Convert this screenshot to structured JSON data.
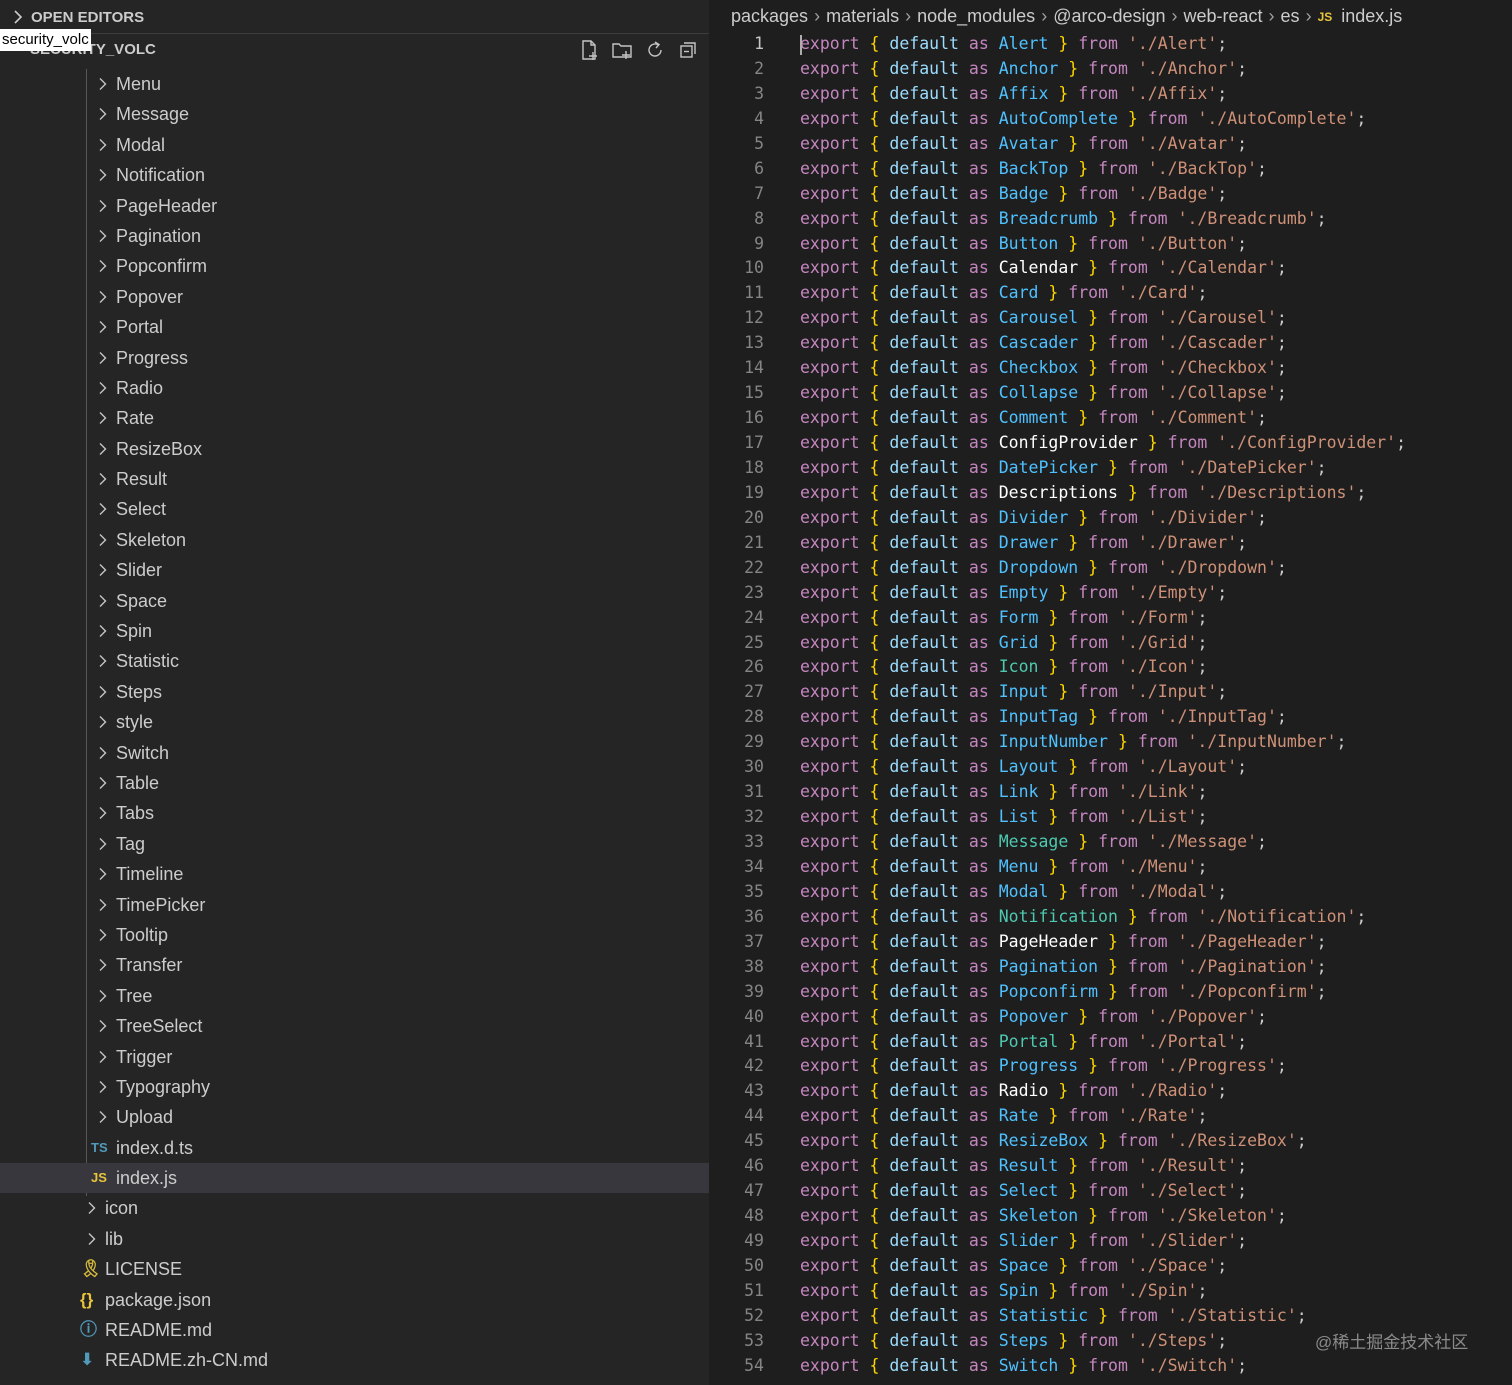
{
  "open_editors": {
    "label": "OPEN EDITORS"
  },
  "tooltip": "security_volc",
  "workspace_title": "SECURITY_VOLC",
  "explorer_actions": [
    {
      "name": "new-file-icon"
    },
    {
      "name": "new-folder-icon"
    },
    {
      "name": "refresh-icon"
    },
    {
      "name": "collapse-all-icon"
    }
  ],
  "tree": [
    {
      "label": "Menu",
      "kind": "folder",
      "depth": 2
    },
    {
      "label": "Message",
      "kind": "folder",
      "depth": 2
    },
    {
      "label": "Modal",
      "kind": "folder",
      "depth": 2
    },
    {
      "label": "Notification",
      "kind": "folder",
      "depth": 2
    },
    {
      "label": "PageHeader",
      "kind": "folder",
      "depth": 2
    },
    {
      "label": "Pagination",
      "kind": "folder",
      "depth": 2
    },
    {
      "label": "Popconfirm",
      "kind": "folder",
      "depth": 2
    },
    {
      "label": "Popover",
      "kind": "folder",
      "depth": 2
    },
    {
      "label": "Portal",
      "kind": "folder",
      "depth": 2
    },
    {
      "label": "Progress",
      "kind": "folder",
      "depth": 2
    },
    {
      "label": "Radio",
      "kind": "folder",
      "depth": 2
    },
    {
      "label": "Rate",
      "kind": "folder",
      "depth": 2
    },
    {
      "label": "ResizeBox",
      "kind": "folder",
      "depth": 2
    },
    {
      "label": "Result",
      "kind": "folder",
      "depth": 2
    },
    {
      "label": "Select",
      "kind": "folder",
      "depth": 2
    },
    {
      "label": "Skeleton",
      "kind": "folder",
      "depth": 2
    },
    {
      "label": "Slider",
      "kind": "folder",
      "depth": 2
    },
    {
      "label": "Space",
      "kind": "folder",
      "depth": 2
    },
    {
      "label": "Spin",
      "kind": "folder",
      "depth": 2
    },
    {
      "label": "Statistic",
      "kind": "folder",
      "depth": 2
    },
    {
      "label": "Steps",
      "kind": "folder",
      "depth": 2
    },
    {
      "label": "style",
      "kind": "folder",
      "depth": 2
    },
    {
      "label": "Switch",
      "kind": "folder",
      "depth": 2
    },
    {
      "label": "Table",
      "kind": "folder",
      "depth": 2
    },
    {
      "label": "Tabs",
      "kind": "folder",
      "depth": 2
    },
    {
      "label": "Tag",
      "kind": "folder",
      "depth": 2
    },
    {
      "label": "Timeline",
      "kind": "folder",
      "depth": 2
    },
    {
      "label": "TimePicker",
      "kind": "folder",
      "depth": 2
    },
    {
      "label": "Tooltip",
      "kind": "folder",
      "depth": 2
    },
    {
      "label": "Transfer",
      "kind": "folder",
      "depth": 2
    },
    {
      "label": "Tree",
      "kind": "folder",
      "depth": 2
    },
    {
      "label": "TreeSelect",
      "kind": "folder",
      "depth": 2
    },
    {
      "label": "Trigger",
      "kind": "folder",
      "depth": 2
    },
    {
      "label": "Typography",
      "kind": "folder",
      "depth": 2
    },
    {
      "label": "Upload",
      "kind": "folder",
      "depth": 2
    },
    {
      "label": "index.d.ts",
      "kind": "file",
      "depth": 2,
      "icon": "TS",
      "icon_color": "#519aba"
    },
    {
      "label": "index.js",
      "kind": "file",
      "depth": 2,
      "icon": "JS",
      "icon_color": "#e8c53a",
      "selected": true
    },
    {
      "label": "icon",
      "kind": "folder",
      "depth": 1
    },
    {
      "label": "lib",
      "kind": "folder",
      "depth": 1
    },
    {
      "label": "LICENSE",
      "kind": "file",
      "depth": 1,
      "icon": "license-icon",
      "icon_color": "#d4b83c"
    },
    {
      "label": "package.json",
      "kind": "file",
      "depth": 1,
      "icon": "json-icon",
      "icon_color": "#e8c53a"
    },
    {
      "label": "README.md",
      "kind": "file",
      "depth": 1,
      "icon": "info-icon",
      "icon_color": "#519aba"
    },
    {
      "label": "README.zh-CN.md",
      "kind": "file",
      "depth": 1,
      "icon": "download-icon",
      "icon_color": "#519aba"
    }
  ],
  "breadcrumb": [
    "packages",
    "materials",
    "node_modules",
    "@arco-design",
    "web-react",
    "es",
    "index.js"
  ],
  "breadcrumb_file_icon": "JS",
  "code": {
    "kw": "export",
    "default": "default",
    "as": "as",
    "from": "from",
    "lines": [
      {
        "n": "1",
        "name": "Alert",
        "path": "'./Alert'"
      },
      {
        "n": "2",
        "name": "Anchor",
        "path": "'./Anchor'"
      },
      {
        "n": "3",
        "name": "Affix",
        "path": "'./Affix'"
      },
      {
        "n": "4",
        "name": "AutoComplete",
        "path": "'./AutoComplete'"
      },
      {
        "n": "5",
        "name": "Avatar",
        "path": "'./Avatar'"
      },
      {
        "n": "6",
        "name": "BackTop",
        "path": "'./BackTop'"
      },
      {
        "n": "7",
        "name": "Badge",
        "path": "'./Badge'"
      },
      {
        "n": "8",
        "name": "Breadcrumb",
        "path": "'./Breadcrumb'"
      },
      {
        "n": "9",
        "name": "Button",
        "path": "'./Button'"
      },
      {
        "n": "10",
        "name": "Calendar",
        "path": "'./Calendar'",
        "white": true
      },
      {
        "n": "11",
        "name": "Card",
        "path": "'./Card'"
      },
      {
        "n": "12",
        "name": "Carousel",
        "path": "'./Carousel'"
      },
      {
        "n": "13",
        "name": "Cascader",
        "path": "'./Cascader'"
      },
      {
        "n": "14",
        "name": "Checkbox",
        "path": "'./Checkbox'"
      },
      {
        "n": "15",
        "name": "Collapse",
        "path": "'./Collapse'"
      },
      {
        "n": "16",
        "name": "Comment",
        "path": "'./Comment'"
      },
      {
        "n": "17",
        "name": "ConfigProvider",
        "path": "'./ConfigProvider'",
        "white": true
      },
      {
        "n": "18",
        "name": "DatePicker",
        "path": "'./DatePicker'"
      },
      {
        "n": "19",
        "name": "Descriptions",
        "path": "'./Descriptions'",
        "white": true
      },
      {
        "n": "20",
        "name": "Divider",
        "path": "'./Divider'"
      },
      {
        "n": "21",
        "name": "Drawer",
        "path": "'./Drawer'"
      },
      {
        "n": "22",
        "name": "Dropdown",
        "path": "'./Dropdown'"
      },
      {
        "n": "23",
        "name": "Empty",
        "path": "'./Empty'"
      },
      {
        "n": "24",
        "name": "Form",
        "path": "'./Form'"
      },
      {
        "n": "25",
        "name": "Grid",
        "path": "'./Grid'"
      },
      {
        "n": "26",
        "name": "Icon",
        "path": "'./Icon'",
        "cls": true
      },
      {
        "n": "27",
        "name": "Input",
        "path": "'./Input'"
      },
      {
        "n": "28",
        "name": "InputTag",
        "path": "'./InputTag'"
      },
      {
        "n": "29",
        "name": "InputNumber",
        "path": "'./InputNumber'"
      },
      {
        "n": "30",
        "name": "Layout",
        "path": "'./Layout'"
      },
      {
        "n": "31",
        "name": "Link",
        "path": "'./Link'"
      },
      {
        "n": "32",
        "name": "List",
        "path": "'./List'"
      },
      {
        "n": "33",
        "name": "Message",
        "path": "'./Message'",
        "cls": true
      },
      {
        "n": "34",
        "name": "Menu",
        "path": "'./Menu'"
      },
      {
        "n": "35",
        "name": "Modal",
        "path": "'./Modal'"
      },
      {
        "n": "36",
        "name": "Notification",
        "path": "'./Notification'",
        "cls": true
      },
      {
        "n": "37",
        "name": "PageHeader",
        "path": "'./PageHeader'",
        "white": true
      },
      {
        "n": "38",
        "name": "Pagination",
        "path": "'./Pagination'"
      },
      {
        "n": "39",
        "name": "Popconfirm",
        "path": "'./Popconfirm'"
      },
      {
        "n": "40",
        "name": "Popover",
        "path": "'./Popover'"
      },
      {
        "n": "41",
        "name": "Portal",
        "path": "'./Portal'",
        "cls": true
      },
      {
        "n": "42",
        "name": "Progress",
        "path": "'./Progress'"
      },
      {
        "n": "43",
        "name": "Radio",
        "path": "'./Radio'",
        "white": true
      },
      {
        "n": "44",
        "name": "Rate",
        "path": "'./Rate'"
      },
      {
        "n": "45",
        "name": "ResizeBox",
        "path": "'./ResizeBox'"
      },
      {
        "n": "46",
        "name": "Result",
        "path": "'./Result'"
      },
      {
        "n": "47",
        "name": "Select",
        "path": "'./Select'"
      },
      {
        "n": "48",
        "name": "Skeleton",
        "path": "'./Skeleton'"
      },
      {
        "n": "49",
        "name": "Slider",
        "path": "'./Slider'"
      },
      {
        "n": "50",
        "name": "Space",
        "path": "'./Space'"
      },
      {
        "n": "51",
        "name": "Spin",
        "path": "'./Spin'"
      },
      {
        "n": "52",
        "name": "Statistic",
        "path": "'./Statistic'"
      },
      {
        "n": "53",
        "name": "Steps",
        "path": "'./Steps'"
      },
      {
        "n": "54",
        "name": "Switch",
        "path": "'./Switch'"
      }
    ]
  },
  "watermark": "@稀土掘金技术社区",
  "colors": {
    "sidebar_bg": "#252526",
    "editor_bg": "#1e1e1e",
    "selected_row_bg": "#37373d",
    "keyword": "#c586c0",
    "bracket": "#ffd700",
    "default_kw": "#9cdcfe",
    "identifier": "#4fc1ff",
    "string": "#ce9178"
  }
}
